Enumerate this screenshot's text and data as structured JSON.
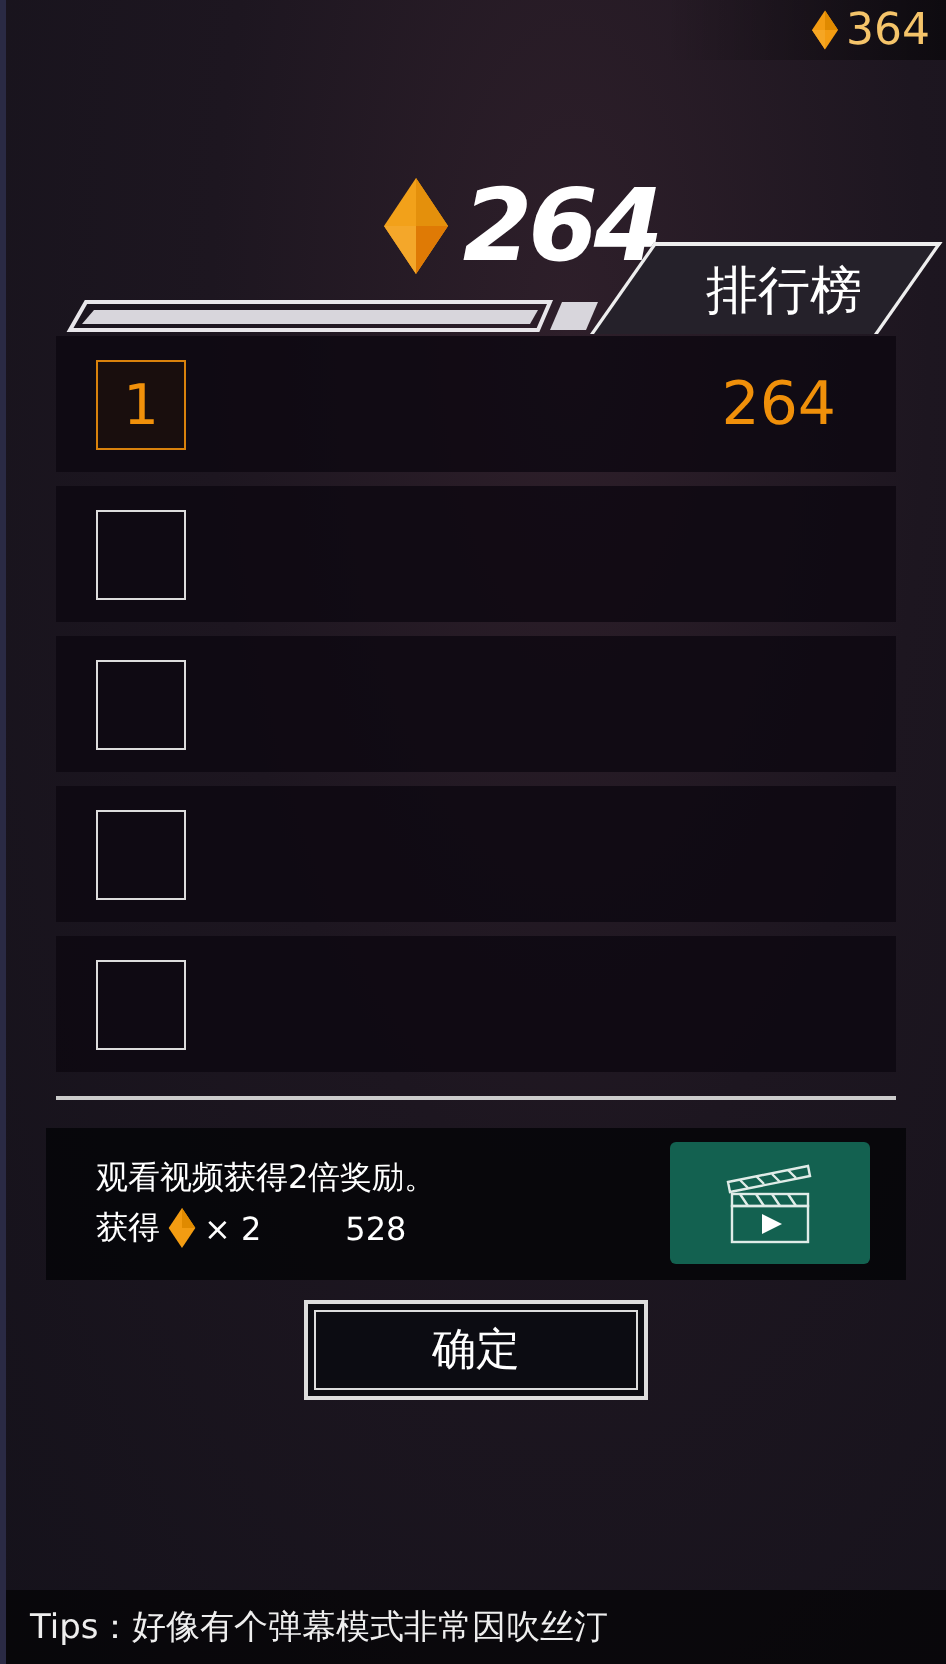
{
  "top_bar": {
    "coins": "364"
  },
  "header": {
    "score": "264",
    "title": "排行榜"
  },
  "rows": [
    {
      "rank": "1",
      "score": "264",
      "highlighted": true
    },
    {
      "highlighted": false
    },
    {
      "highlighted": false
    },
    {
      "highlighted": false
    },
    {
      "highlighted": false
    }
  ],
  "reward": {
    "text": "观看视频获得2倍奖励。",
    "gain_label": "获得",
    "multiplier": "× 2",
    "total": "528"
  },
  "confirm_button": "确定",
  "tips": "Tips：好像有个弹幕模式非常因吹丝汀"
}
